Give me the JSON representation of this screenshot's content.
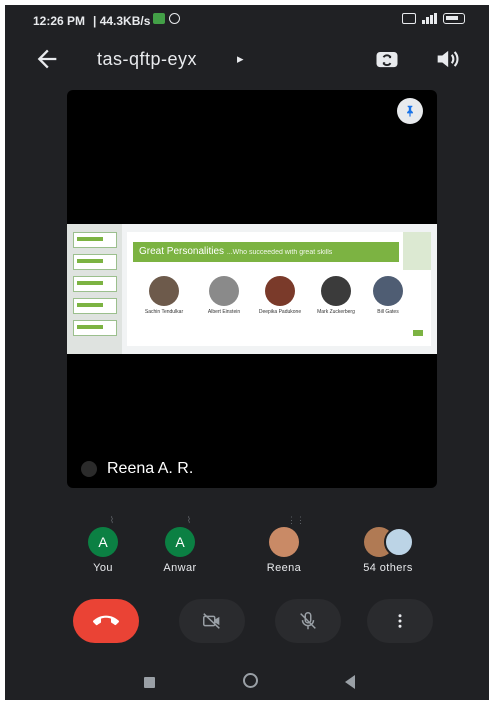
{
  "status_bar": {
    "time": "12:26 PM",
    "net_rate": "| 44.3KB/s"
  },
  "top_bar": {
    "meeting_code": "tas-qftp-eyx",
    "caret": "▸"
  },
  "main_tile": {
    "name": "Reena A. R.",
    "slide": {
      "title": "Great Personalities",
      "subtitle": "...Who succeeded with great skills",
      "people": [
        {
          "name": "Sachin Tendulkar",
          "color": "#6d5a4b"
        },
        {
          "name": "Albert Einstein",
          "color": "#8a8a8a"
        },
        {
          "name": "Deepika Padukone",
          "color": "#7a3a2a"
        },
        {
          "name": "Mark Zuckerberg",
          "color": "#3b3b3b"
        },
        {
          "name": "Bill Gates",
          "color": "#4f5d73"
        }
      ]
    }
  },
  "participants": [
    {
      "label": "You",
      "initial": "A",
      "color": "#0b8043"
    },
    {
      "label": "Anwar",
      "initial": "A",
      "color": "#0b8043"
    },
    {
      "label": "Reena",
      "initial": "",
      "color": "#c98a66"
    },
    {
      "label": "54 others",
      "initial": "",
      "color": "#b07a54"
    }
  ],
  "colors": {
    "background": "#202124",
    "end_call": "#ea4335",
    "control": "#2a2b2e",
    "accent_green": "#7cb342"
  }
}
